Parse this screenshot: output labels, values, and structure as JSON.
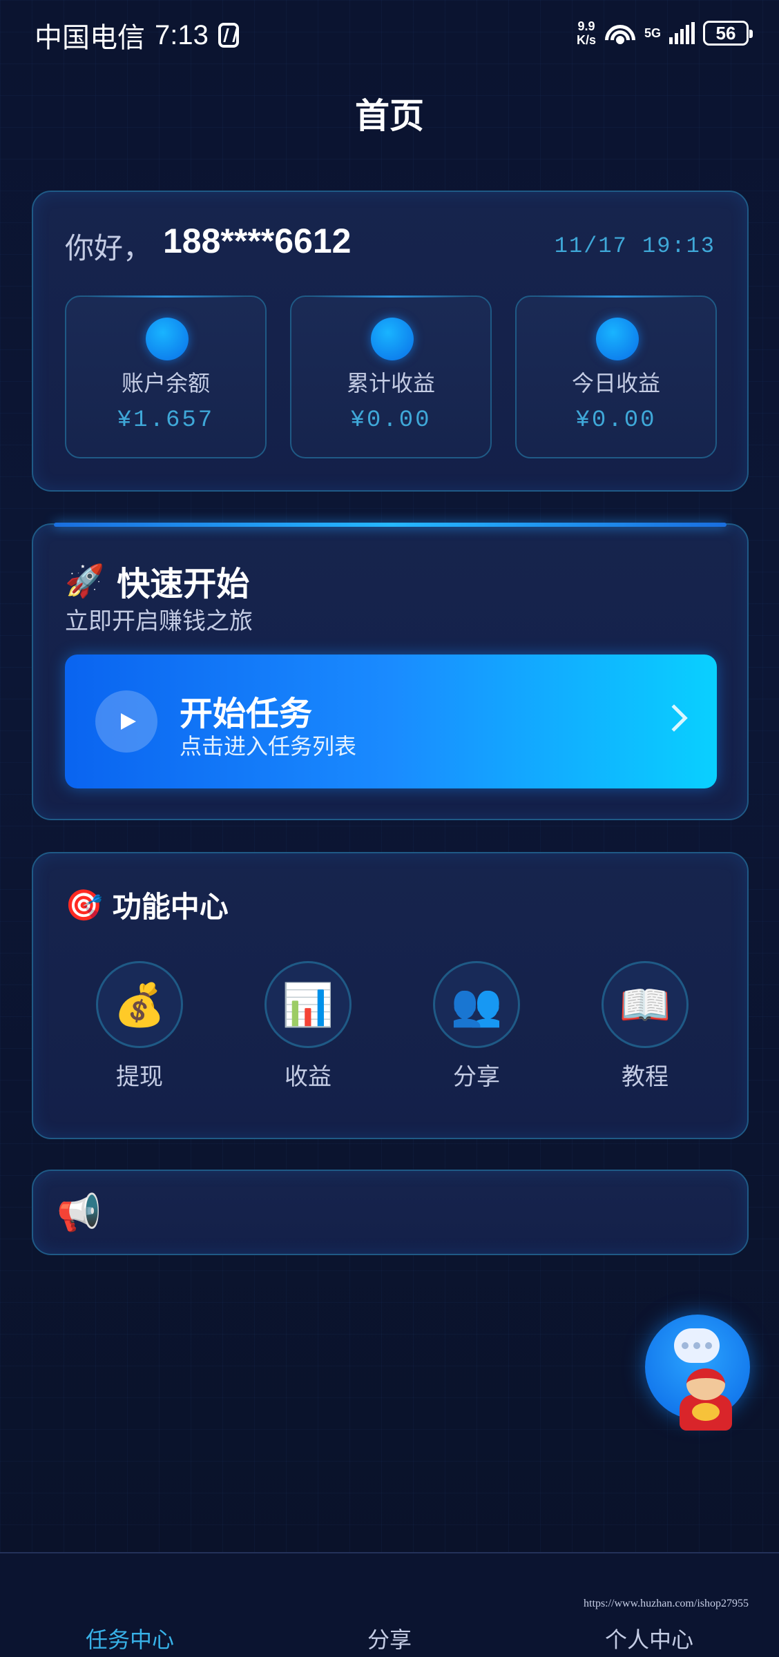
{
  "status_bar": {
    "carrier": "中国电信",
    "time": "7:13",
    "net_speed_value": "9.9",
    "net_speed_unit": "K/s",
    "network": "5G",
    "battery": "56"
  },
  "header": {
    "title": "首页"
  },
  "account": {
    "greeting": "你好，",
    "phone": "188****6612",
    "datetime": "11/17 19:13",
    "stats": [
      {
        "label": "账户余额",
        "value": "¥1.657"
      },
      {
        "label": "累计收益",
        "value": "¥0.00"
      },
      {
        "label": "今日收益",
        "value": "¥0.00"
      }
    ]
  },
  "quick_start": {
    "icon": "rocket-icon",
    "title": "快速开始",
    "subtitle": "立即开启赚钱之旅",
    "button": {
      "title": "开始任务",
      "subtitle": "点击进入任务列表"
    }
  },
  "functions": {
    "icon": "target-icon",
    "title": "功能中心",
    "items": [
      {
        "label": "提现",
        "icon": "money-bag-icon"
      },
      {
        "label": "收益",
        "icon": "bar-chart-icon"
      },
      {
        "label": "分享",
        "icon": "users-icon"
      },
      {
        "label": "教程",
        "icon": "book-icon"
      }
    ]
  },
  "notice": {
    "icon": "megaphone-icon",
    "text": ""
  },
  "watermark": "https://www.huzhan.com/ishop27955",
  "bottom_nav": {
    "items": [
      {
        "label": "任务中心",
        "active": true
      },
      {
        "label": "分享",
        "active": false
      },
      {
        "label": "个人中心",
        "active": false
      }
    ]
  },
  "colors": {
    "accent": "#38b2e8",
    "button_gradient_start": "#0a64f0",
    "button_gradient_end": "#09d0ff",
    "background": "#0b1430"
  }
}
